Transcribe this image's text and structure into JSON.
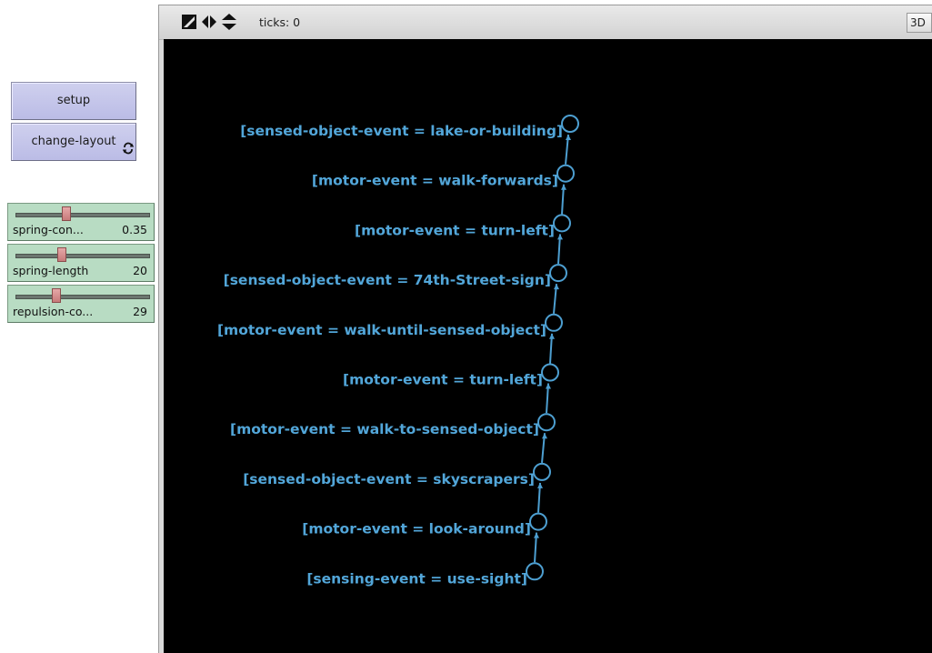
{
  "buttons": {
    "setup": "setup",
    "change_layout": "change-layout"
  },
  "sliders": [
    {
      "name": "spring-con...",
      "value": "0.35",
      "fraction": 0.37
    },
    {
      "name": "spring-length",
      "value": "20",
      "fraction": 0.33
    },
    {
      "name": "repulsion-co...",
      "value": "29",
      "fraction": 0.29
    }
  ],
  "view": {
    "ticks_label": "ticks: 0",
    "three_d_label": "3D",
    "toolbar_icons": [
      "view-size-icon",
      "horizontal-wrap-arrows-icon",
      "vertical-wrap-arrows-icon"
    ],
    "background_color": "#000000",
    "link_color": "#4d9fd1",
    "label_color": "#52a6d9"
  },
  "nodes": [
    {
      "label": "[sensed-object-event = lake-or-building]"
    },
    {
      "label": "[motor-event = walk-forwards]"
    },
    {
      "label": "[motor-event = turn-left]"
    },
    {
      "label": "[sensed-object-event = 74th-Street-sign]"
    },
    {
      "label": "[motor-event = walk-until-sensed-object]"
    },
    {
      "label": "[motor-event = turn-left]"
    },
    {
      "label": "[motor-event = walk-to-sensed-object]"
    },
    {
      "label": "[sensed-object-event = skyscrapers]"
    },
    {
      "label": "[motor-event = look-around]"
    },
    {
      "label": "[sensing-event = use-sight]"
    }
  ]
}
